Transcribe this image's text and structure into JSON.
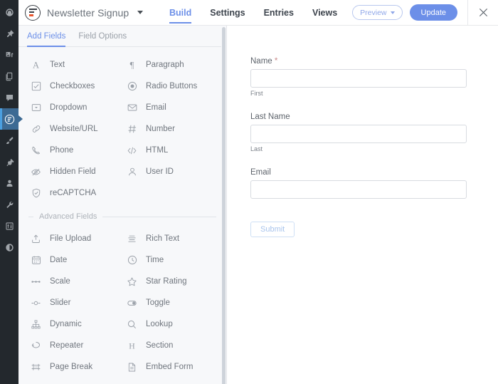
{
  "admin_rail": {
    "items": [
      {
        "icon": "dashboard-icon",
        "name": "rail-item-dashboard",
        "active": false
      },
      {
        "icon": "pin-icon",
        "name": "rail-item-posts",
        "active": false
      },
      {
        "icon": "media-icon",
        "name": "rail-item-media",
        "active": false
      },
      {
        "icon": "pages-icon",
        "name": "rail-item-pages",
        "active": false
      },
      {
        "icon": "comments-icon",
        "name": "rail-item-comments",
        "active": false
      },
      {
        "icon": "formidable-icon",
        "name": "rail-item-formidable-forms",
        "active": true
      },
      {
        "icon": "brush-icon",
        "name": "rail-item-appearance",
        "active": false
      },
      {
        "icon": "plug-icon",
        "name": "rail-item-plugins",
        "active": false
      },
      {
        "icon": "user-icon",
        "name": "rail-item-users",
        "active": false
      },
      {
        "icon": "wrench-icon",
        "name": "rail-item-tools",
        "active": false
      },
      {
        "icon": "sliders-icon",
        "name": "rail-item-settings",
        "active": false
      },
      {
        "icon": "collapse-icon",
        "name": "rail-item-collapse-menu",
        "active": false
      }
    ]
  },
  "topbar": {
    "logo": "formidable-logo-icon",
    "form_title": "Newsletter Signup",
    "tabs": [
      {
        "label": "Build",
        "active": true
      },
      {
        "label": "Settings",
        "active": false
      },
      {
        "label": "Entries",
        "active": false
      },
      {
        "label": "Views",
        "active": false
      }
    ],
    "preview_label": "Preview",
    "update_label": "Update",
    "close_label": "✕"
  },
  "fields_panel": {
    "tabs": [
      {
        "label": "Add Fields",
        "active": true
      },
      {
        "label": "Field Options",
        "active": false
      }
    ],
    "basic_fields": [
      {
        "label": "Text",
        "icon": "text-icon"
      },
      {
        "label": "Paragraph",
        "icon": "paragraph-icon"
      },
      {
        "label": "Checkboxes",
        "icon": "checkbox-icon"
      },
      {
        "label": "Radio Buttons",
        "icon": "radio-icon"
      },
      {
        "label": "Dropdown",
        "icon": "dropdown-icon"
      },
      {
        "label": "Email",
        "icon": "email-icon"
      },
      {
        "label": "Website/URL",
        "icon": "link-icon"
      },
      {
        "label": "Number",
        "icon": "number-icon"
      },
      {
        "label": "Phone",
        "icon": "phone-icon"
      },
      {
        "label": "HTML",
        "icon": "code-icon"
      },
      {
        "label": "Hidden Field",
        "icon": "eye-off-icon"
      },
      {
        "label": "User ID",
        "icon": "user-icon"
      },
      {
        "label": "reCAPTCHA",
        "icon": "shield-check-icon"
      }
    ],
    "advanced_section_label": "Advanced Fields",
    "advanced_fields": [
      {
        "label": "File Upload",
        "icon": "upload-icon"
      },
      {
        "label": "Rich Text",
        "icon": "rich-text-icon"
      },
      {
        "label": "Date",
        "icon": "calendar-icon"
      },
      {
        "label": "Time",
        "icon": "clock-icon"
      },
      {
        "label": "Scale",
        "icon": "scale-icon"
      },
      {
        "label": "Star Rating",
        "icon": "star-icon"
      },
      {
        "label": "Slider",
        "icon": "slider-icon"
      },
      {
        "label": "Toggle",
        "icon": "toggle-icon"
      },
      {
        "label": "Dynamic",
        "icon": "dynamic-icon"
      },
      {
        "label": "Lookup",
        "icon": "search-icon"
      },
      {
        "label": "Repeater",
        "icon": "repeater-icon"
      },
      {
        "label": "Section",
        "icon": "heading-icon"
      },
      {
        "label": "Page Break",
        "icon": "page-break-icon"
      },
      {
        "label": "Embed Form",
        "icon": "embed-form-icon"
      }
    ]
  },
  "form_preview": {
    "fields": [
      {
        "label": "Name",
        "required": true,
        "required_mark": "*",
        "sub_label": "First",
        "value": ""
      },
      {
        "label": "Last Name",
        "required": false,
        "required_mark": "",
        "sub_label": "Last",
        "value": ""
      },
      {
        "label": "Email",
        "required": false,
        "required_mark": "",
        "sub_label": "",
        "value": ""
      }
    ],
    "submit_label": "Submit"
  },
  "colors": {
    "accent_blue": "#6c8fe8",
    "rail_bg": "#23282d",
    "rail_active_bg": "#3d6a93",
    "rail_active_bar": "#4b9fe0",
    "panel_bg": "#f7f8fa",
    "logo_orange": "#e8552d",
    "required_red": "#c98b8b"
  }
}
